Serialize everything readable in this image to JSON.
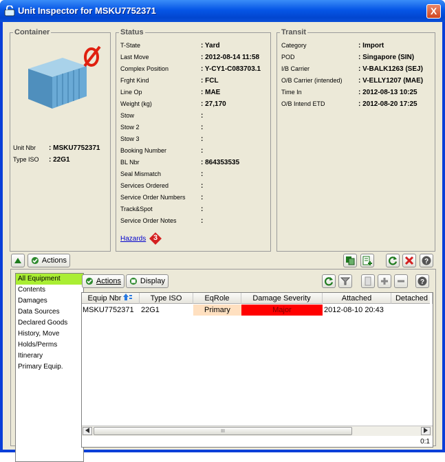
{
  "window": {
    "title": "Unit Inspector for MSKU7752371",
    "close_label": "X"
  },
  "container": {
    "title": "Container",
    "unit_nbr_label": "Unit Nbr",
    "unit_nbr_value": ": MSKU7752371",
    "type_iso_label": "Type ISO",
    "type_iso_value": ": 22G1"
  },
  "status": {
    "title": "Status",
    "rows": [
      {
        "label": "T-State",
        "value": ": Yard"
      },
      {
        "label": "Last Move",
        "value": ": 2012-08-14 11:58"
      },
      {
        "label": "Complex Position",
        "value": ": Y-CY1-C083703.1"
      },
      {
        "label": "Frght Kind",
        "value": ": FCL"
      },
      {
        "label": "Line Op",
        "value": ": MAE"
      },
      {
        "label": "Weight (kg)",
        "value": ": 27,170"
      },
      {
        "label": "Stow",
        "value": ":"
      },
      {
        "label": "Stow 2",
        "value": ":"
      },
      {
        "label": "Stow 3",
        "value": ":"
      },
      {
        "label": "Booking Number",
        "value": ":"
      },
      {
        "label": "BL Nbr",
        "value": ": 864353535"
      },
      {
        "label": "Seal Mismatch",
        "value": ":"
      },
      {
        "label": "Services Ordered",
        "value": ":"
      },
      {
        "label": "Service Order Numbers",
        "value": ":"
      },
      {
        "label": "Track&Spot",
        "value": ":"
      },
      {
        "label": "Service Order Notes",
        "value": ":"
      }
    ],
    "hazards_link": "Hazards",
    "hazards_badge": "3"
  },
  "transit": {
    "title": "Transit",
    "rows": [
      {
        "label": "Category",
        "value": ": Import"
      },
      {
        "label": "POD",
        "value": ": Singapore (SIN)"
      },
      {
        "label": "I/B Carrier",
        "value": ": V-BALK1263 (SEJ)"
      },
      {
        "label": "O/B Carrier (intended)",
        "value": ": V-ELLY1207 (MAE)"
      },
      {
        "label": "Time In",
        "value": ": 2012-08-13 10:25"
      },
      {
        "label": "O/B Intend ETD",
        "value": ": 2012-08-20 17:25"
      }
    ]
  },
  "toolbar": {
    "actions_label": "Actions"
  },
  "sidebar": {
    "items": [
      "All Equipment",
      "Contents",
      "Damages",
      "Data Sources",
      "Declared Goods",
      "History, Move",
      "Holds/Perms",
      "Itinerary",
      "Primary Equip."
    ]
  },
  "grid_toolbar": {
    "actions_label": "Actions",
    "display_label": "Display"
  },
  "grid": {
    "columns": [
      "Equip Nbr",
      "Type ISO",
      "EqRole",
      "Damage Severity",
      "Attached",
      "Detached"
    ],
    "rows": [
      {
        "equip_nbr": "MSKU7752371",
        "type_iso": "22G1",
        "eq_role": "Primary",
        "damage_severity": "Major",
        "attached": "2012-08-10 20:43",
        "detached": ""
      }
    ],
    "scroll_glyph": "III",
    "count": "0:1"
  },
  "colors": {
    "damage_major": "#ff0000",
    "primary_role": "#ffe0c0",
    "selected_item": "#aaee33"
  }
}
